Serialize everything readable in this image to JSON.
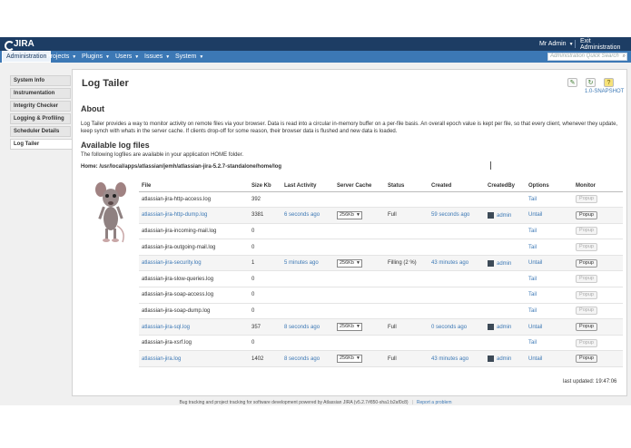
{
  "header": {
    "brand": "JIRA",
    "user": "Mr Admin",
    "exit": "Exit Administration"
  },
  "menu": {
    "items": [
      {
        "label": "Administration",
        "caret": ""
      },
      {
        "label": "Projects",
        "caret": "▼"
      },
      {
        "label": "Plugins",
        "caret": "▼"
      },
      {
        "label": "Users",
        "caret": "▼"
      },
      {
        "label": "Issues",
        "caret": "▼"
      },
      {
        "label": "System",
        "caret": "▼"
      }
    ],
    "search_placeholder": "Administration Quick Search"
  },
  "sidebar": {
    "items": [
      {
        "label": "System Info"
      },
      {
        "label": "Instrumentation"
      },
      {
        "label": "Integrity Checker"
      },
      {
        "label": "Logging & Profiling"
      },
      {
        "label": "Scheduler Details"
      },
      {
        "label": "Log Tailer"
      }
    ]
  },
  "page": {
    "title": "Log Tailer",
    "version": "1.0-SNAPSHOT",
    "about_heading": "About",
    "about_text": "Log Tailer provides a way to monitor activity on remote files via your browser. Data is read into a circular in-memory buffer on a per-file basis. An overall epoch value is kept per file, so that every client, whenever they update, keep synch with whats in the server cache. If clients drop-off for some reason, their browser data is flushed and new data is loaded.",
    "files_heading": "Available log files",
    "files_text": "The following logfiles are available in your application HOME folder.",
    "home": "Home: /usr/local/apps/atlassian/jemh/atlassian-jira-5.2.7-standalone/home/log",
    "last_updated": "last updated: 19:47:06"
  },
  "table": {
    "headers": [
      "File",
      "Size Kb",
      "Last Activity",
      "Server Cache",
      "Status",
      "Created",
      "CreatedBy",
      "Options",
      "Monitor"
    ],
    "rows": [
      {
        "file": "atlassian-jira-http-access.log",
        "size": "392",
        "activity": "",
        "cache": "",
        "status": "",
        "created": "",
        "by": "",
        "option": "Tail",
        "monitor": "Popup",
        "active": false
      },
      {
        "file": "atlassian-jira-http-dump.log",
        "size": "3381",
        "activity": "6 seconds ago",
        "cache": "256Kb",
        "status": "Full",
        "created": "59 seconds ago",
        "by": "admin",
        "option": "Untail",
        "monitor": "Popup",
        "active": true
      },
      {
        "file": "atlassian-jira-incoming-mail.log",
        "size": "0",
        "activity": "",
        "cache": "",
        "status": "",
        "created": "",
        "by": "",
        "option": "Tail",
        "monitor": "Popup",
        "active": false
      },
      {
        "file": "atlassian-jira-outgoing-mail.log",
        "size": "0",
        "activity": "",
        "cache": "",
        "status": "",
        "created": "",
        "by": "",
        "option": "Tail",
        "monitor": "Popup",
        "active": false
      },
      {
        "file": "atlassian-jira-security.log",
        "size": "1",
        "activity": "5 minutes ago",
        "cache": "256Kb",
        "status": "Filling (2 %)",
        "created": "43 minutes ago",
        "by": "admin",
        "option": "Untail",
        "monitor": "Popup",
        "active": true
      },
      {
        "file": "atlassian-jira-slow-queries.log",
        "size": "0",
        "activity": "",
        "cache": "",
        "status": "",
        "created": "",
        "by": "",
        "option": "Tail",
        "monitor": "Popup",
        "active": false
      },
      {
        "file": "atlassian-jira-soap-access.log",
        "size": "0",
        "activity": "",
        "cache": "",
        "status": "",
        "created": "",
        "by": "",
        "option": "Tail",
        "monitor": "Popup",
        "active": false
      },
      {
        "file": "atlassian-jira-soap-dump.log",
        "size": "0",
        "activity": "",
        "cache": "",
        "status": "",
        "created": "",
        "by": "",
        "option": "Tail",
        "monitor": "Popup",
        "active": false
      },
      {
        "file": "atlassian-jira-sql.log",
        "size": "357",
        "activity": "8 seconds ago",
        "cache": "256Kb",
        "status": "Full",
        "created": "0 seconds ago",
        "by": "admin",
        "option": "Untail",
        "monitor": "Popup",
        "active": true
      },
      {
        "file": "atlassian-jira-xsrf.log",
        "size": "0",
        "activity": "",
        "cache": "",
        "status": "",
        "created": "",
        "by": "",
        "option": "Tail",
        "monitor": "Popup",
        "active": false
      },
      {
        "file": "atlassian-jira.log",
        "size": "1402",
        "activity": "8 seconds ago",
        "cache": "256Kb",
        "status": "Full",
        "created": "43 minutes ago",
        "by": "admin",
        "option": "Untail",
        "monitor": "Popup",
        "active": true
      }
    ]
  },
  "footer": {
    "text": "Bug tracking and project tracking for software development powered by Atlassian JIRA (v5.2.7#850-sha1:b2af0c8)",
    "report": "Report a problem"
  },
  "icons": {
    "cache_caret": "▼",
    "quicksearch": "search-icon"
  },
  "colors": {
    "topbar": "#1d3d64",
    "menubar": "#3c78b5",
    "link": "#3c78b5"
  }
}
